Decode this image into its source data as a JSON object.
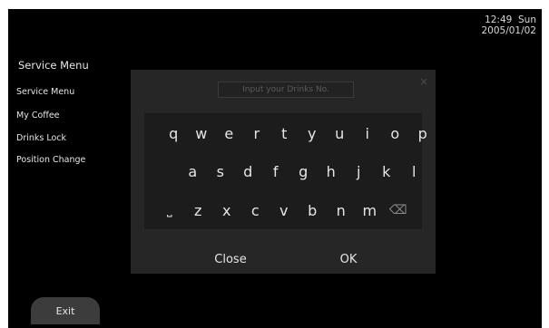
{
  "status": {
    "time": "12:49",
    "day": "Sun",
    "date": "2005/01/02"
  },
  "sidebar": {
    "title": "Service Menu",
    "items": [
      {
        "label": "Service Menu",
        "name": "sidebar-item-service-menu"
      },
      {
        "label": "My Coffee",
        "name": "sidebar-item-my-coffee"
      },
      {
        "label": "Drinks Lock",
        "name": "sidebar-item-drinks-lock"
      },
      {
        "label": "Position Change",
        "name": "sidebar-item-position-change"
      }
    ],
    "exit_label": "Exit"
  },
  "dialog": {
    "input_placeholder": "Input your Drinks No.",
    "close_icon": "×",
    "keyboard": {
      "rows": [
        [
          "q",
          "w",
          "e",
          "r",
          "t",
          "y",
          "u",
          "i",
          "o",
          "p"
        ],
        [
          "a",
          "s",
          "d",
          "f",
          "g",
          "h",
          "j",
          "k",
          "l"
        ],
        [
          "space",
          "z",
          "x",
          "c",
          "v",
          "b",
          "n",
          "m",
          "backspace"
        ]
      ],
      "space_glyph": "⎵",
      "backspace_glyph": "⌫"
    },
    "close_label": "Close",
    "ok_label": "OK"
  },
  "colors": {
    "screen_bg": "#000000",
    "dialog_bg": "#262626",
    "keyboard_bg": "#1c1c1c",
    "text": "#e6e6e6",
    "exit_button_bg": "#3c3c3c"
  }
}
